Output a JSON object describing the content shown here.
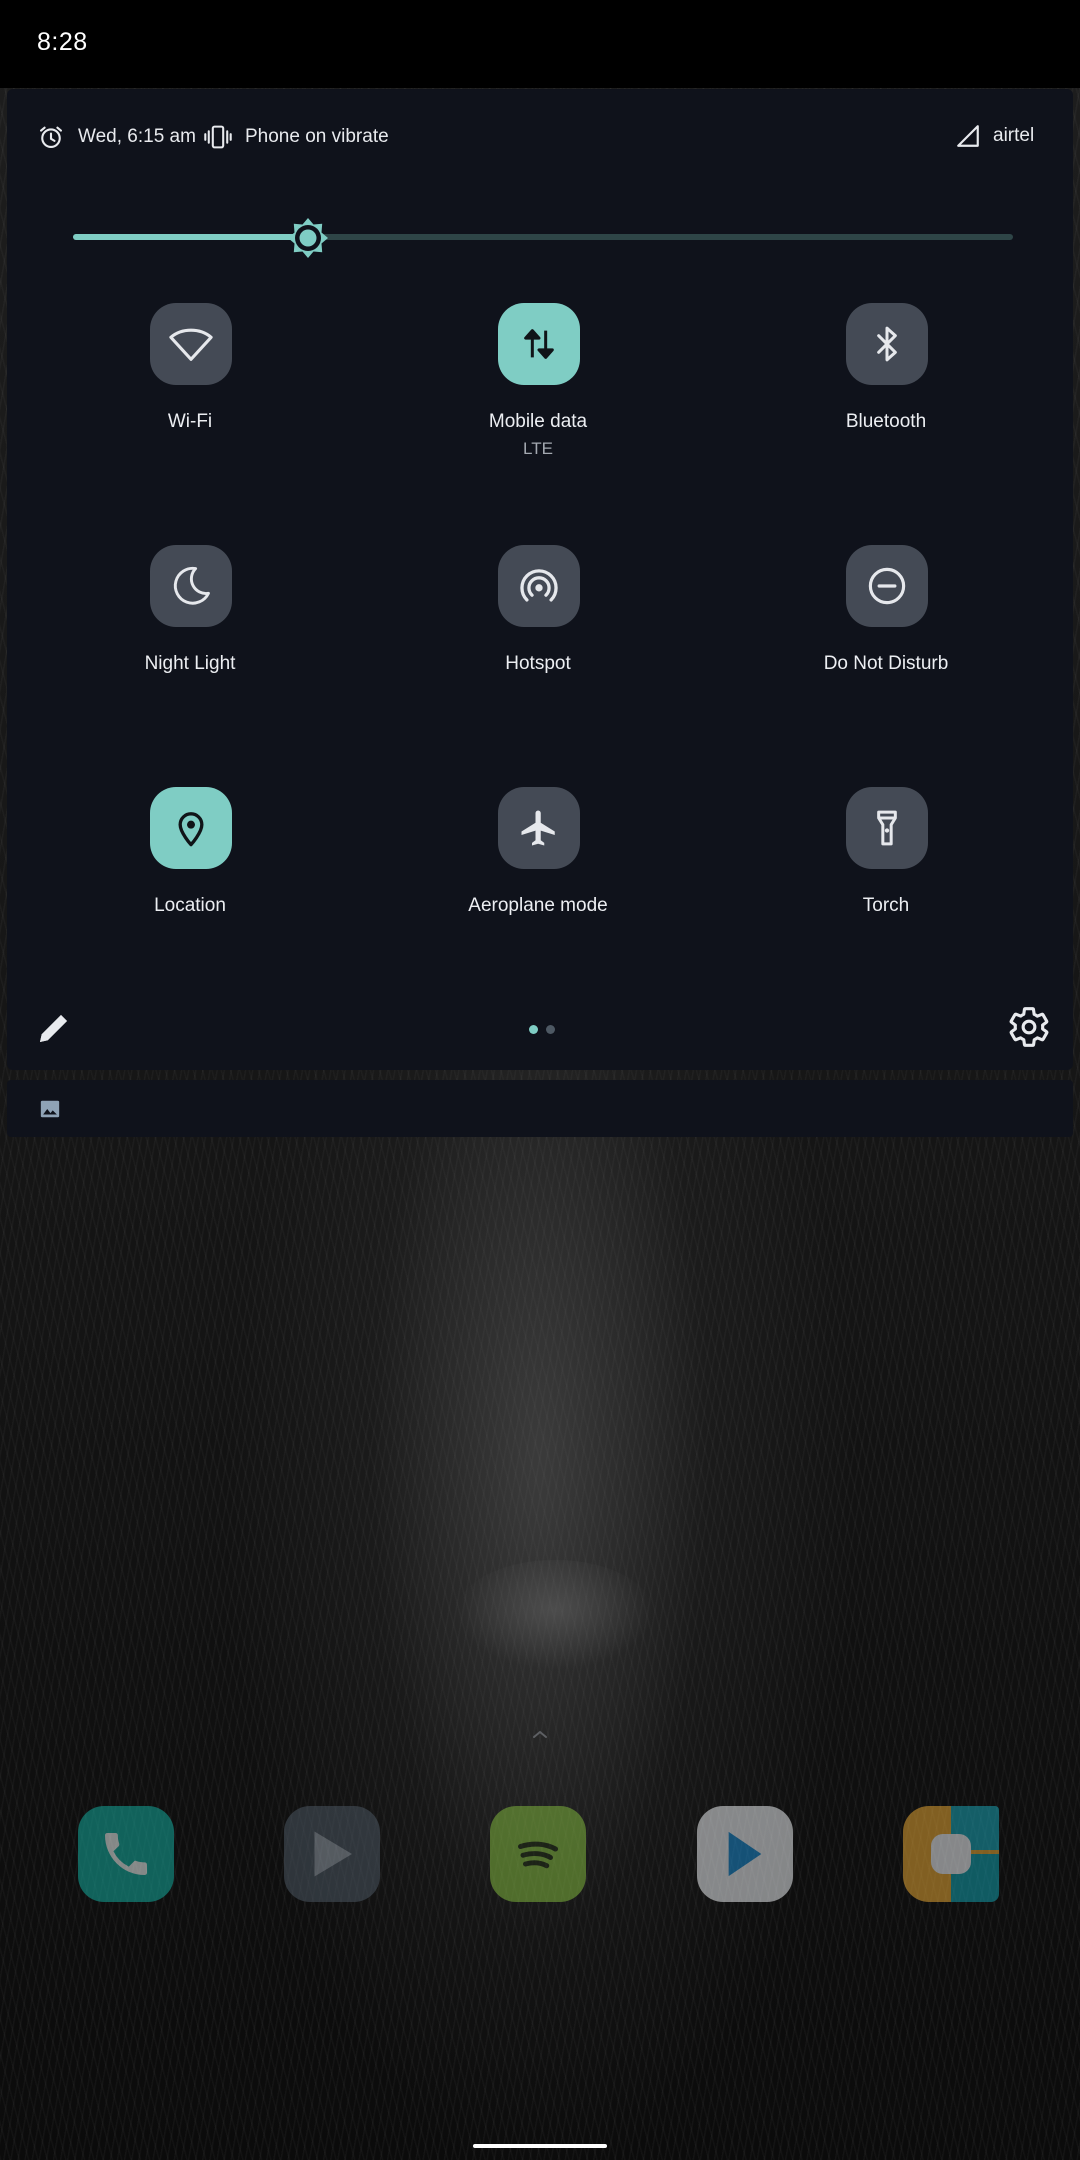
{
  "status_bar": {
    "time": "8:28"
  },
  "header": {
    "alarm": "Wed, 6:15 am",
    "ringer": "Phone on vibrate",
    "carrier": "airtel"
  },
  "brightness": {
    "level": 0.25
  },
  "tiles": [
    {
      "label": "Wi-Fi",
      "sub": "",
      "active": false,
      "icon": "wifi-icon"
    },
    {
      "label": "Mobile data",
      "sub": "LTE",
      "active": true,
      "icon": "mobile-data-icon"
    },
    {
      "label": "Bluetooth",
      "sub": "",
      "active": false,
      "icon": "bluetooth-icon"
    },
    {
      "label": "Night Light",
      "sub": "",
      "active": false,
      "icon": "night-light-icon"
    },
    {
      "label": "Hotspot",
      "sub": "",
      "active": false,
      "icon": "hotspot-icon"
    },
    {
      "label": "Do Not Disturb",
      "sub": "",
      "active": false,
      "icon": "do-not-disturb-icon"
    },
    {
      "label": "Location",
      "sub": "",
      "active": true,
      "icon": "location-icon"
    },
    {
      "label": "Aeroplane mode",
      "sub": "",
      "active": false,
      "icon": "aeroplane-icon"
    },
    {
      "label": "Torch",
      "sub": "",
      "active": false,
      "icon": "torch-icon"
    }
  ],
  "pager": {
    "pages": 2,
    "current": 1
  },
  "colors": {
    "accent": "#7fcdc4",
    "panel": "#0f121b",
    "tile_inactive": "#444a55"
  },
  "dock": [
    {
      "name": "Phone",
      "icon": "phone-app-icon"
    },
    {
      "name": "Play Movies",
      "icon": "play-movies-icon"
    },
    {
      "name": "Spotify",
      "icon": "spotify-icon"
    },
    {
      "name": "Play Store",
      "icon": "play-store-icon"
    },
    {
      "name": "Drive",
      "icon": "drive-icon"
    }
  ]
}
